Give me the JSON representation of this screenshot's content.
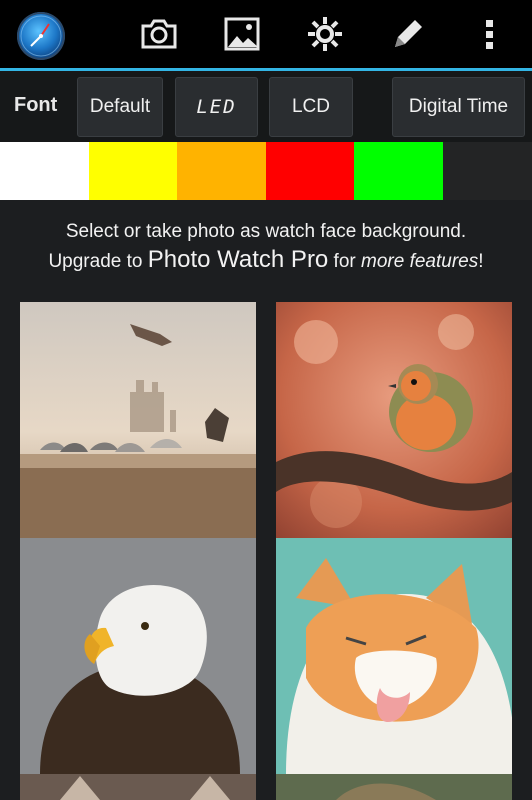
{
  "toolbar": {
    "icons": [
      "app-logo-icon",
      "camera-icon",
      "image-icon",
      "settings-sun-icon",
      "pencil-icon",
      "overflow-menu-icon"
    ],
    "accent_color": "#33b5e5"
  },
  "font_bar": {
    "label": "Font",
    "options": [
      {
        "label": "Default"
      },
      {
        "label": "LED"
      },
      {
        "label": "LCD"
      },
      {
        "label": "Digital Time"
      }
    ]
  },
  "colors": [
    "#ffffff",
    "#ffff00",
    "#ffb300",
    "#ff0000",
    "#00ff00",
    "#232425"
  ],
  "message": {
    "line1": "Select or take photo as watch face background.",
    "upgrade_prefix": "Upgrade to ",
    "product": "Photo Watch Pro",
    "for_text": " for ",
    "features": "more features",
    "suffix": "!"
  },
  "photos": [
    "birds-on-wall-photo",
    "robin-on-branch-photo",
    "bald-eagle-photo",
    "cat-licking-photo",
    "partial-photo-left",
    "partial-photo-right"
  ]
}
